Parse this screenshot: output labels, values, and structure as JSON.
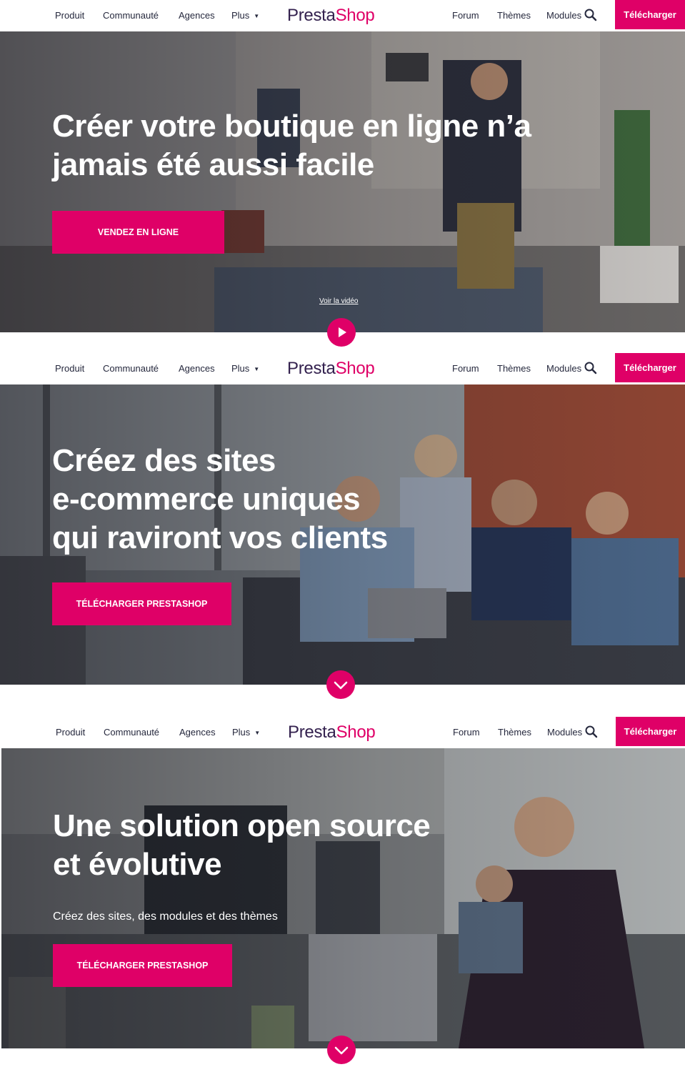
{
  "colors": {
    "brand_pink": "#df0067",
    "brand_navy": "#34224f",
    "nav_text": "#25283d",
    "white": "#ffffff"
  },
  "nav": {
    "left_items": [
      "Produit",
      "Communauté",
      "Agences",
      "Plus"
    ],
    "right_items": [
      "Forum",
      "Thèmes",
      "Modules"
    ],
    "logo_part1": "Presta",
    "logo_part2": "Shop",
    "download_label": "Télécharger",
    "search_icon": "search-icon",
    "plus_icon": "caret-down-icon"
  },
  "screens": [
    {
      "headline": [
        "Créer votre boutique en ligne n’a",
        "jamais été aussi facile"
      ],
      "cta_label": "VENDEZ EN LIGNE",
      "video_link": "Voir la vidéo",
      "round_icon": "play-icon"
    },
    {
      "headline": [
        "Créez des sites",
        "e-commerce uniques",
        "qui raviront vos clients"
      ],
      "cta_label": "TÉLÉCHARGER PRESTASHOP",
      "round_icon": "chevron-down-icon"
    },
    {
      "headline": [
        "Une solution open source",
        "et évolutive"
      ],
      "subtitle": "Créez des sites, des modules et des thèmes",
      "cta_label": "TÉLÉCHARGER PRESTASHOP",
      "round_icon": "chevron-down-icon"
    }
  ]
}
